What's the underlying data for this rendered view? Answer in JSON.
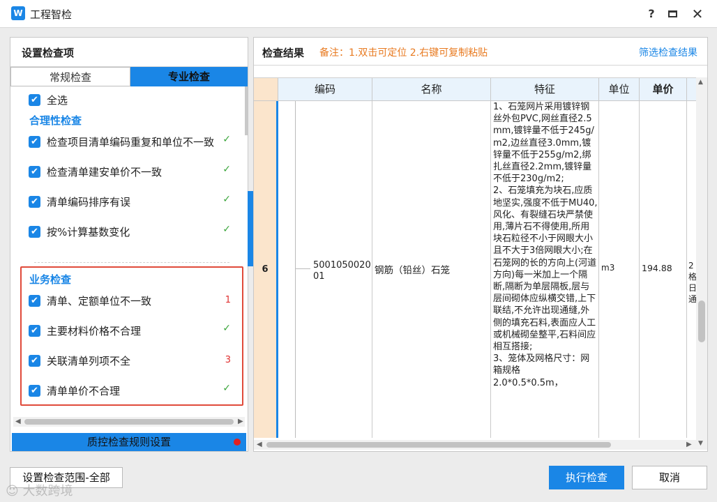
{
  "window": {
    "logo_text": "W",
    "title": "工程智检",
    "help": "?",
    "close": "✕"
  },
  "left_panel": {
    "title": "设置检查项",
    "tabs": [
      {
        "label": "常规检查",
        "active": false
      },
      {
        "label": "专业检查",
        "active": true
      }
    ],
    "select_all": "全选",
    "sections": [
      {
        "title": "合理性检查",
        "items": [
          {
            "label": "检查项目清单编码重复和单位不一致",
            "checked": true,
            "result": "✓"
          },
          {
            "label": "检查清单建安单价不一致",
            "checked": true,
            "result": "✓"
          },
          {
            "label": "清单编码排序有误",
            "checked": true,
            "result": "✓"
          },
          {
            "label": "按%计算基数变化",
            "checked": true,
            "result": "✓"
          }
        ]
      },
      {
        "title": "业务检查",
        "items": [
          {
            "label": "清单、定额单位不一致",
            "checked": true,
            "result": "1"
          },
          {
            "label": "主要材料价格不合理",
            "checked": true,
            "result": "✓"
          },
          {
            "label": "关联清单列项不全",
            "checked": true,
            "result": "3"
          },
          {
            "label": "清单单价不合理",
            "checked": true,
            "result": "✓"
          }
        ]
      }
    ],
    "qc_button": "质控检查规则设置"
  },
  "right_panel": {
    "title": "检查结果",
    "note": "备注：1.双击可定位 2.右键可复制粘贴",
    "filter_link": "筛选检查结果",
    "columns": [
      "编码",
      "名称",
      "特征",
      "单位",
      "单价"
    ],
    "rows": [
      {
        "index": "6",
        "code": "500105002001",
        "name": "钢筋（铅丝）石笼",
        "feature": "1、石笼网片采用镀锌钢丝外包PVC,网丝直径2.5mm,镀锌量不低于245g/m2,边丝直径3.0mm,镀锌量不低于255g/m2,绑扎丝直径2.2mm,镀锌量不低于230g/m2;\n2、石笼填充为块石,应质地坚实,强度不低于MU40,风化、有裂缝石块严禁使用,薄片石不得使用,所用块石粒径不小于网眼大小且不大于3倍网眼大小;在石笼网的长的方向上(河道方向)每一米加上一个隔断,隔断为单层隔板,层与层间砌体应纵横交错,上下联结,不允许出现通缝,外侧的填充石料,表面应人工或机械砌垒整平,石料间应相互搭接;\n3、笼体及网格尺寸：网箱规格\n2.0*0.5*0.5m，",
        "unit": "m3",
        "price": "194.88",
        "more": "2\n格\n日\n通"
      }
    ]
  },
  "buttons": {
    "scope": "设置检查范围-全部",
    "run": "执行检查",
    "cancel": "取消"
  },
  "watermark": "大数跨境",
  "colors": {
    "accent": "#1a86e6",
    "ok": "#3aa53a",
    "error": "#e03030",
    "note": "#e87a20",
    "highlight_box": "#e04a3a"
  }
}
